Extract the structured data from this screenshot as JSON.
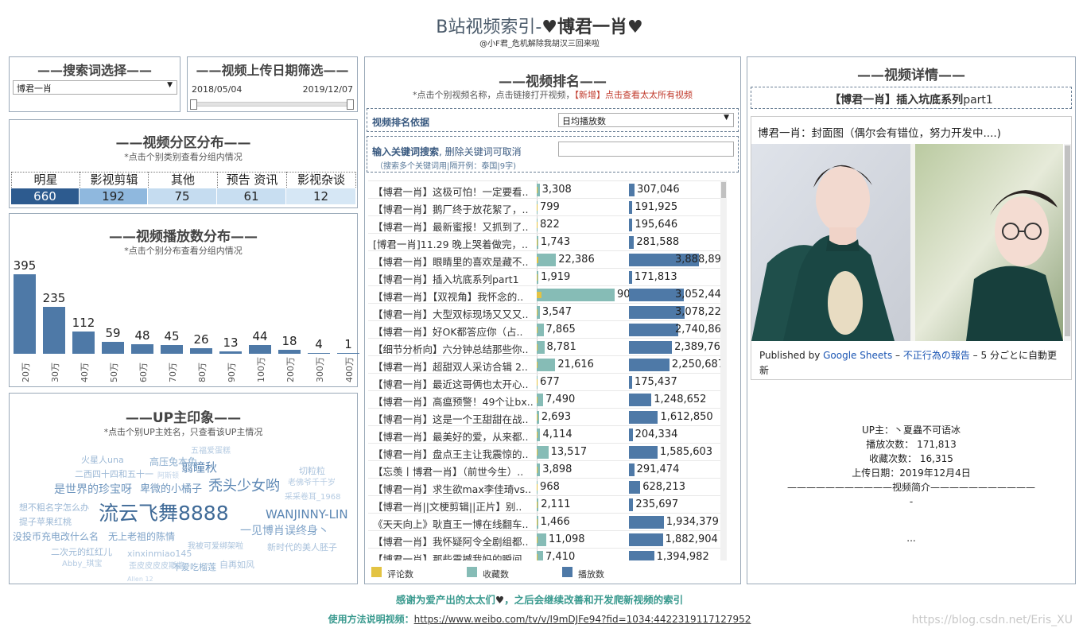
{
  "header": {
    "title_prefix": "B站视频索引-",
    "title_heart1": "♥",
    "title_name": "博君一肖",
    "title_heart2": "♥",
    "subtitle": "@小F君_危机解除我胡汉三回来啦"
  },
  "search_panel": {
    "title": "——搜索词选择——",
    "selected": "博君一肖"
  },
  "date_panel": {
    "title": "——视频上传日期筛选——",
    "start": "2018/05/04",
    "end": "2019/12/07"
  },
  "category_panel": {
    "title": "——视频分区分布——",
    "subtitle": "*点击个别类别查看分组内情况",
    "categories": [
      {
        "name": "明星",
        "count": "660",
        "color": "#2d5b8f",
        "text_color": "#ffffff"
      },
      {
        "name": "影视剪辑",
        "count": "192",
        "color": "#8fb8de",
        "text_color": "#222222"
      },
      {
        "name": "其他",
        "count": "75",
        "color": "#c5dcf0",
        "text_color": "#222222"
      },
      {
        "name": "预告 资讯",
        "count": "61",
        "color": "#c8def1",
        "text_color": "#222222"
      },
      {
        "name": "影视杂谈",
        "count": "12",
        "color": "#d6e7f5",
        "text_color": "#222222"
      }
    ]
  },
  "views_panel": {
    "title": "——视频播放数分布——",
    "subtitle": "*点击个别分布查看分组内情况",
    "chart_data": {
      "type": "bar",
      "categories": [
        "20万",
        "30万",
        "40万",
        "50万",
        "60万",
        "70万",
        "80万",
        "90万",
        "100万",
        "200万",
        "300万",
        "400万"
      ],
      "values": [
        395,
        235,
        112,
        59,
        48,
        45,
        26,
        13,
        44,
        18,
        4,
        1
      ],
      "ylim": [
        0,
        395
      ],
      "color": "#4e79a7"
    }
  },
  "up_panel": {
    "title": "——UP主印象——",
    "subtitle": "*点击个别UP主姓名，只查看该UP主情况",
    "words": [
      {
        "t": "流云飞舞8888",
        "c": "#3f6a97"
      },
      {
        "t": "秃头少女哟",
        "c": "#5b86b3"
      },
      {
        "t": "WANJINNY-LIN",
        "c": "#5b86b3"
      },
      {
        "t": "翦瞳秋",
        "c": "#5b86b3"
      },
      {
        "t": "是世界的珍宝呀",
        "c": "#6f96be"
      },
      {
        "t": "卑微的小橘子",
        "c": "#6f96be"
      },
      {
        "t": "一见博肖误终身丶",
        "c": "#7fa3c8"
      },
      {
        "t": "没投币充电改什么名",
        "c": "#7fa3c8"
      },
      {
        "t": "无上老祖的陈情",
        "c": "#7fa3c8"
      },
      {
        "t": "高压兔本兔",
        "c": "#8fb0d0"
      },
      {
        "t": "火星人una",
        "c": "#9db9d6"
      },
      {
        "t": "二西四十四和五十一",
        "c": "#9db9d6"
      },
      {
        "t": "想不粗名字怎么办",
        "c": "#9db9d6"
      },
      {
        "t": "提子苹果红桃",
        "c": "#9db9d6"
      },
      {
        "t": "二次元的红红儿",
        "c": "#9db9d6"
      },
      {
        "t": "xinxinmiao145",
        "c": "#a9c2dc"
      },
      {
        "t": "我被可爱绑架啦",
        "c": "#a9c2dc"
      },
      {
        "t": "新时代的美人胚子",
        "c": "#a9c2dc"
      },
      {
        "t": "自再如风",
        "c": "#a9c2dc"
      },
      {
        "t": "不爱吃榴莲",
        "c": "#8fb0d0"
      },
      {
        "t": "歪皮皮皮皮斯酱",
        "c": "#b5cbe2"
      },
      {
        "t": "Abby_琪宝",
        "c": "#b5cbe2"
      },
      {
        "t": "切粒粒",
        "c": "#a9c2dc"
      },
      {
        "t": "老佛爷千千岁",
        "c": "#b5cbe2"
      },
      {
        "t": "采采卷耳_1968",
        "c": "#b5cbe2"
      },
      {
        "t": "五福爱蛋糕",
        "c": "#b5cbe2"
      },
      {
        "t": "阿斯顿",
        "c": "#c2d4e8"
      },
      {
        "t": "Allen 12",
        "c": "#c2d4e8"
      }
    ]
  },
  "ranking_panel": {
    "title": "——视频排名——",
    "note_prefix": "*点击个别视频名称，点击链接打开视频，",
    "note_new": "【新增】点击查看太太所有视频",
    "sort_label": "视频排名依据",
    "sort_value": "日均播放数",
    "keyword_label_a": "输入关键词搜索",
    "keyword_label_b": ", 删除关键词可取消",
    "keyword_hint": "（搜索多个关键词用|隔开例：泰国|9字)",
    "legend": [
      {
        "name": "评论数",
        "color": "#e3c343"
      },
      {
        "name": "收藏数",
        "color": "#86bcb6"
      },
      {
        "name": "播放数",
        "color": "#4e79a7"
      }
    ],
    "rows": [
      {
        "title": "【博君一肖】这极可怕！一定要看..",
        "comments": 40,
        "fav": 3308,
        "fav_s": "3,308",
        "plays": 307046,
        "plays_s": "307,046"
      },
      {
        "title": "【博君一肖】鹅厂终于放花絮了，..",
        "comments": 10,
        "fav": 799,
        "fav_s": "799",
        "plays": 191925,
        "plays_s": "191,925"
      },
      {
        "title": "【博君一肖】最新蜜报！又抓到了..",
        "comments": 10,
        "fav": 822,
        "fav_s": "822",
        "plays": 195646,
        "plays_s": "195,646"
      },
      {
        "title": "[博君一肖]11.29 晚上哭着做完，..",
        "comments": 20,
        "fav": 1743,
        "fav_s": "1,743",
        "plays": 281588,
        "plays_s": "281,588"
      },
      {
        "title": "【博君一肖】眼睛里的喜欢是藏不..",
        "comments": 1500,
        "fav": 22386,
        "fav_s": "22,386",
        "plays": 3888893,
        "plays_s": "3,888,893"
      },
      {
        "title": "【博君一肖】插入坑底系列part1",
        "comments": 30,
        "fav": 1919,
        "fav_s": "1,919",
        "plays": 171813,
        "plays_s": "171,813"
      },
      {
        "title": "【博君一肖】【双视角】我怀念的..",
        "comments": 6000,
        "fav": 90492,
        "fav_s": "90,492",
        "plays": 3052447,
        "plays_s": "3,052,447"
      },
      {
        "title": "【博君一肖】大型双标现场又又又..",
        "comments": 200,
        "fav": 3547,
        "fav_s": "3,547",
        "plays": 3078221,
        "plays_s": "3,078,221"
      },
      {
        "title": "【博君一肖】好OK都答应你（占..",
        "comments": 400,
        "fav": 7865,
        "fav_s": "7,865",
        "plays": 2740865,
        "plays_s": "2,740,865"
      },
      {
        "title": "【细节分析向】六分钟总结那些你..",
        "comments": 300,
        "fav": 8781,
        "fav_s": "8,781",
        "plays": 2389768,
        "plays_s": "2,389,768"
      },
      {
        "title": "【博君一肖】超甜双人采访合辑 2..",
        "comments": 900,
        "fav": 21616,
        "fav_s": "21,616",
        "plays": 2250687,
        "plays_s": "2,250,687"
      },
      {
        "title": "【博君一肖】最近这哥俩也太开心..",
        "comments": 10,
        "fav": 677,
        "fav_s": "677",
        "plays": 175437,
        "plays_s": "175,437"
      },
      {
        "title": "【博君一肖】高瘟预警！49个让bx..",
        "comments": 300,
        "fav": 7490,
        "fav_s": "7,490",
        "plays": 1248652,
        "plays_s": "1,248,652"
      },
      {
        "title": "【博君一肖】这是一个王甜甜在战..",
        "comments": 80,
        "fav": 2693,
        "fav_s": "2,693",
        "plays": 1612850,
        "plays_s": "1,612,850"
      },
      {
        "title": "【博君一肖】最美好的爱，从来都..",
        "comments": 100,
        "fav": 4114,
        "fav_s": "4,114",
        "plays": 204334,
        "plays_s": "204,334"
      },
      {
        "title": "【博君一肖】盘点王主让我震惊的..",
        "comments": 600,
        "fav": 13517,
        "fav_s": "13,517",
        "plays": 1585603,
        "plays_s": "1,585,603"
      },
      {
        "title": "【忘羡丨博君一肖】（前世今生）..",
        "comments": 150,
        "fav": 3898,
        "fav_s": "3,898",
        "plays": 291474,
        "plays_s": "291,474"
      },
      {
        "title": "【博君一肖】求生欲max李佳琦vs..",
        "comments": 30,
        "fav": 968,
        "fav_s": "968",
        "plays": 628213,
        "plays_s": "628,213"
      },
      {
        "title": "【博君一肖||文梗剪辑||正片】别..",
        "comments": 60,
        "fav": 2111,
        "fav_s": "2,111",
        "plays": 235697,
        "plays_s": "235,697"
      },
      {
        "title": "《天天向上》耿直王一博在线翻车..",
        "comments": 40,
        "fav": 1466,
        "fav_s": "1,466",
        "plays": 1934379,
        "plays_s": "1,934,379"
      },
      {
        "title": "【博君一肖】我怀疑阿令全剧组都..",
        "comments": 500,
        "fav": 11098,
        "fav_s": "11,098",
        "plays": 1882904,
        "plays_s": "1,882,904"
      },
      {
        "title": "【博君一肖】那些震撼我妈的瞬间..",
        "comments": 300,
        "fav": 7410,
        "fav_s": "7,410",
        "plays": 1394982,
        "plays_s": "1,394,982"
      }
    ]
  },
  "detail_panel": {
    "title": "——视频详情——",
    "video_title_a": "【博君一肖】",
    "video_title_b": "插入坑底系列",
    "video_title_c": "part1",
    "embed_title": "博君一肖：封面图（偶尔会有错位，努力开发中....)",
    "published_by": "Published by ",
    "google_sheets": "Google Sheets",
    "dash1": " – ",
    "report": "不正行為の報告",
    "dash2": " – ",
    "refresh": "5 分ごとに自動更新",
    "up_line": "UP主：丶夏蟲不可语冰",
    "plays_line": "播放次数： 171,813",
    "fav_line": "收藏次数： 16,315",
    "date_line": "上传日期：2019年12月4日",
    "intro_line": "———————————视频简介———————————",
    "intro_dash": "-",
    "intro_more": "..."
  },
  "footer": {
    "thanks_a": "感谢为爱产出的太太们",
    "thanks_heart": "♥",
    "thanks_b": "，之后会继续改善和开发爬新视频的索引",
    "howto_label": "使用方法说明视频：",
    "howto_url": "https://www.weibo.com/tv/v/I9mDJFe94?fid=1034:4422319117127952",
    "watermark": "https://blog.csdn.net/Eris_XU"
  }
}
